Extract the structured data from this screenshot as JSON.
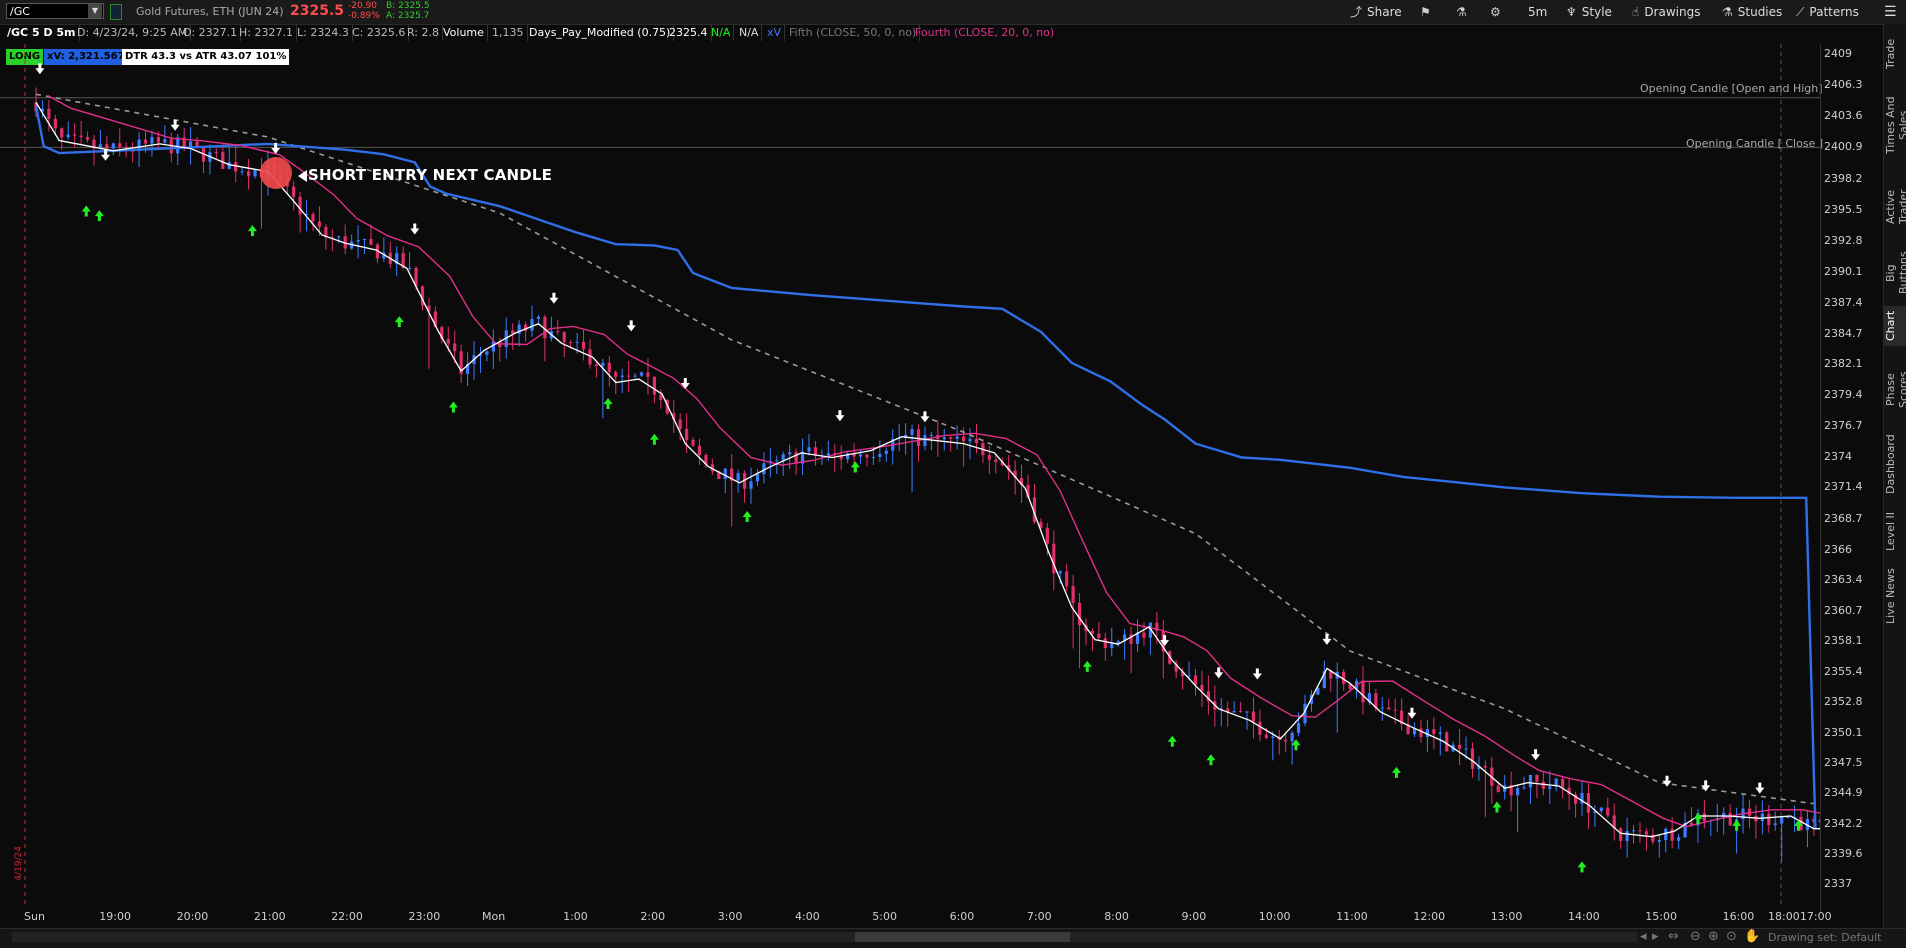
{
  "header": {
    "symbol": "/GC",
    "description": "Gold Futures, ETH (JUN 24)",
    "last": "2325.5",
    "change": "-20.90",
    "change_pct": "-0.89%",
    "bid": "B: 2325.5",
    "ask": "A: 2325.7"
  },
  "toolbar": {
    "share": "Share",
    "period": "5m",
    "style": "Style",
    "drawings": "Drawings",
    "studies": "Studies",
    "patterns": "Patterns"
  },
  "infobar": {
    "chart_id": "/GC 5 D 5m",
    "date": "D: 4/23/24, 9:25 AM",
    "open": "O: 2327.1",
    "high": "H: 2327.1",
    "low": "L: 2324.3",
    "close": "C: 2325.6",
    "range": "R: 2.8",
    "volume_label": "Volume",
    "volume": "1,135",
    "study1": "Days_Pay_Modified (0.75)",
    "study1_val": "2325.4",
    "na1": "N/A",
    "na2": "N/A",
    "xv": "xV",
    "fifth": "Fifth (CLOSE, 50, 0, no)",
    "fourth": "Fourth (CLOSE, 20, 0, no)",
    "long": "LONG",
    "xv_value": "xV: 2,321.5677",
    "dtr": "DTR 43.3 vs ATR 43.07  101%"
  },
  "annotations": {
    "opening_high": "Opening Candle [Open and High]",
    "opening_close": "Opening Candle [ Close ]",
    "short_entry": "SHORT ENTRY NEXT CANDLE",
    "date_marker": "4/19/24"
  },
  "right_tabs": [
    "Trade",
    "Times And Sales",
    "Active Trader",
    "Big Buttons",
    "Chart",
    "Phase Scores",
    "Dashboard",
    "Level II",
    "Live News"
  ],
  "bottom": {
    "drawing_set": "Drawing set: Default"
  },
  "colors": {
    "up": "#3d7bff",
    "down": "#e0306a",
    "vwap": "#2f6fe8",
    "ma_fast": "#ffffff",
    "ma_slow": "#e0308a",
    "buy": "#22ee22",
    "sell": "#ffffff"
  },
  "chart_data": {
    "type": "candlestick",
    "y_ticks": [
      2409,
      2406.3,
      2403.6,
      2400.9,
      2398.2,
      2395.5,
      2392.8,
      2390.1,
      2387.4,
      2384.7,
      2382.1,
      2379.4,
      2376.7,
      2374,
      2371.4,
      2368.7,
      2366,
      2363.4,
      2360.7,
      2358.1,
      2355.4,
      2352.8,
      2350.1,
      2347.5,
      2344.9,
      2342.2,
      2339.6,
      2337
    ],
    "x_ticks": [
      "Sun",
      "19:00",
      "20:00",
      "21:00",
      "22:00",
      "23:00",
      "Mon",
      "1:00",
      "2:00",
      "3:00",
      "4:00",
      "5:00",
      "6:00",
      "7:00",
      "8:00",
      "9:00",
      "10:00",
      "11:00",
      "12:00",
      "13:00",
      "14:00",
      "15:00",
      "16:00",
      "17:00",
      "18:00"
    ],
    "ylim": [
      2336,
      2410
    ],
    "opening_high": 2405.2,
    "opening_close": 2400.9,
    "close_path": [
      [
        0,
        2404.8
      ],
      [
        0.3,
        2401.5
      ],
      [
        1,
        2400.6
      ],
      [
        1.6,
        2401.2
      ],
      [
        2,
        2400.8
      ],
      [
        2.5,
        2399.4
      ],
      [
        3,
        2398.8
      ],
      [
        3.3,
        2396.5
      ],
      [
        3.7,
        2393.3
      ],
      [
        4,
        2392.6
      ],
      [
        4.4,
        2392.0
      ],
      [
        4.8,
        2390.4
      ],
      [
        5.2,
        2385.0
      ],
      [
        5.5,
        2381.5
      ],
      [
        5.8,
        2383.3
      ],
      [
        6.2,
        2384.8
      ],
      [
        6.5,
        2385.6
      ],
      [
        6.8,
        2383.9
      ],
      [
        7.2,
        2382.7
      ],
      [
        7.5,
        2380.5
      ],
      [
        7.8,
        2380.8
      ],
      [
        8.1,
        2379.5
      ],
      [
        8.4,
        2375.2
      ],
      [
        8.7,
        2373.2
      ],
      [
        9.1,
        2371.8
      ],
      [
        9.5,
        2373.2
      ],
      [
        9.9,
        2374.4
      ],
      [
        10.3,
        2374.0
      ],
      [
        10.8,
        2374.6
      ],
      [
        11.2,
        2375.8
      ],
      [
        11.6,
        2375.5
      ],
      [
        12,
        2375.2
      ],
      [
        12.4,
        2374.4
      ],
      [
        12.8,
        2371.3
      ],
      [
        13.1,
        2365.8
      ],
      [
        13.4,
        2361.0
      ],
      [
        13.7,
        2358.2
      ],
      [
        14,
        2357.8
      ],
      [
        14.4,
        2359.3
      ],
      [
        14.7,
        2356.4
      ],
      [
        15,
        2354.2
      ],
      [
        15.3,
        2352.2
      ],
      [
        15.7,
        2351.2
      ],
      [
        16.1,
        2349.6
      ],
      [
        16.4,
        2351.8
      ],
      [
        16.7,
        2355.7
      ],
      [
        17,
        2354.4
      ],
      [
        17.4,
        2351.9
      ],
      [
        17.8,
        2350.6
      ],
      [
        18.2,
        2349.4
      ],
      [
        18.6,
        2347.6
      ],
      [
        19,
        2345.3
      ],
      [
        19.3,
        2345.8
      ],
      [
        19.7,
        2345.5
      ],
      [
        20.1,
        2343.8
      ],
      [
        20.5,
        2341.4
      ],
      [
        20.9,
        2341.1
      ],
      [
        21.2,
        2341.6
      ],
      [
        21.5,
        2342.9
      ],
      [
        21.9,
        2342.9
      ],
      [
        22.3,
        2342.7
      ],
      [
        22.7,
        2342.9
      ],
      [
        23,
        2341.8
      ],
      [
        23.3,
        2341.8
      ],
      [
        23.6,
        2342.6
      ]
    ],
    "vwap_path": [
      [
        0,
        2404.5
      ],
      [
        0.1,
        2401.0
      ],
      [
        0.3,
        2400.4
      ],
      [
        1,
        2400.6
      ],
      [
        2,
        2400.9
      ],
      [
        3,
        2401.2
      ],
      [
        4,
        2400.7
      ],
      [
        4.5,
        2400.3
      ],
      [
        4.9,
        2399.6
      ],
      [
        5.1,
        2397.5
      ],
      [
        5.3,
        2396.9
      ],
      [
        6,
        2395.8
      ],
      [
        7,
        2393.5
      ],
      [
        7.5,
        2392.5
      ],
      [
        8,
        2392.4
      ],
      [
        8.3,
        2392.0
      ],
      [
        8.5,
        2390.0
      ],
      [
        9,
        2388.7
      ],
      [
        10,
        2388.1
      ],
      [
        11,
        2387.6
      ],
      [
        12,
        2387.1
      ],
      [
        12.5,
        2386.9
      ],
      [
        13,
        2384.9
      ],
      [
        13.4,
        2382.2
      ],
      [
        13.9,
        2380.6
      ],
      [
        14.3,
        2378.6
      ],
      [
        14.6,
        2377.3
      ],
      [
        15,
        2375.2
      ],
      [
        15.6,
        2374.0
      ],
      [
        16.1,
        2373.8
      ],
      [
        17,
        2373.1
      ],
      [
        17.7,
        2372.3
      ],
      [
        18.3,
        2371.9
      ],
      [
        19,
        2371.4
      ],
      [
        20,
        2370.9
      ],
      [
        21,
        2370.6
      ],
      [
        22,
        2370.5
      ],
      [
        22.9,
        2370.5
      ],
      [
        23.02,
        2341.8
      ]
    ],
    "trend_path": [
      [
        0,
        2405.5
      ],
      [
        3,
        2401.8
      ],
      [
        6,
        2395.2
      ],
      [
        9,
        2384.2
      ],
      [
        12,
        2376.2
      ],
      [
        15,
        2367.4
      ],
      [
        17,
        2357.2
      ],
      [
        19,
        2352.2
      ],
      [
        21,
        2345.8
      ],
      [
        23.4,
        2343.6
      ]
    ]
  }
}
